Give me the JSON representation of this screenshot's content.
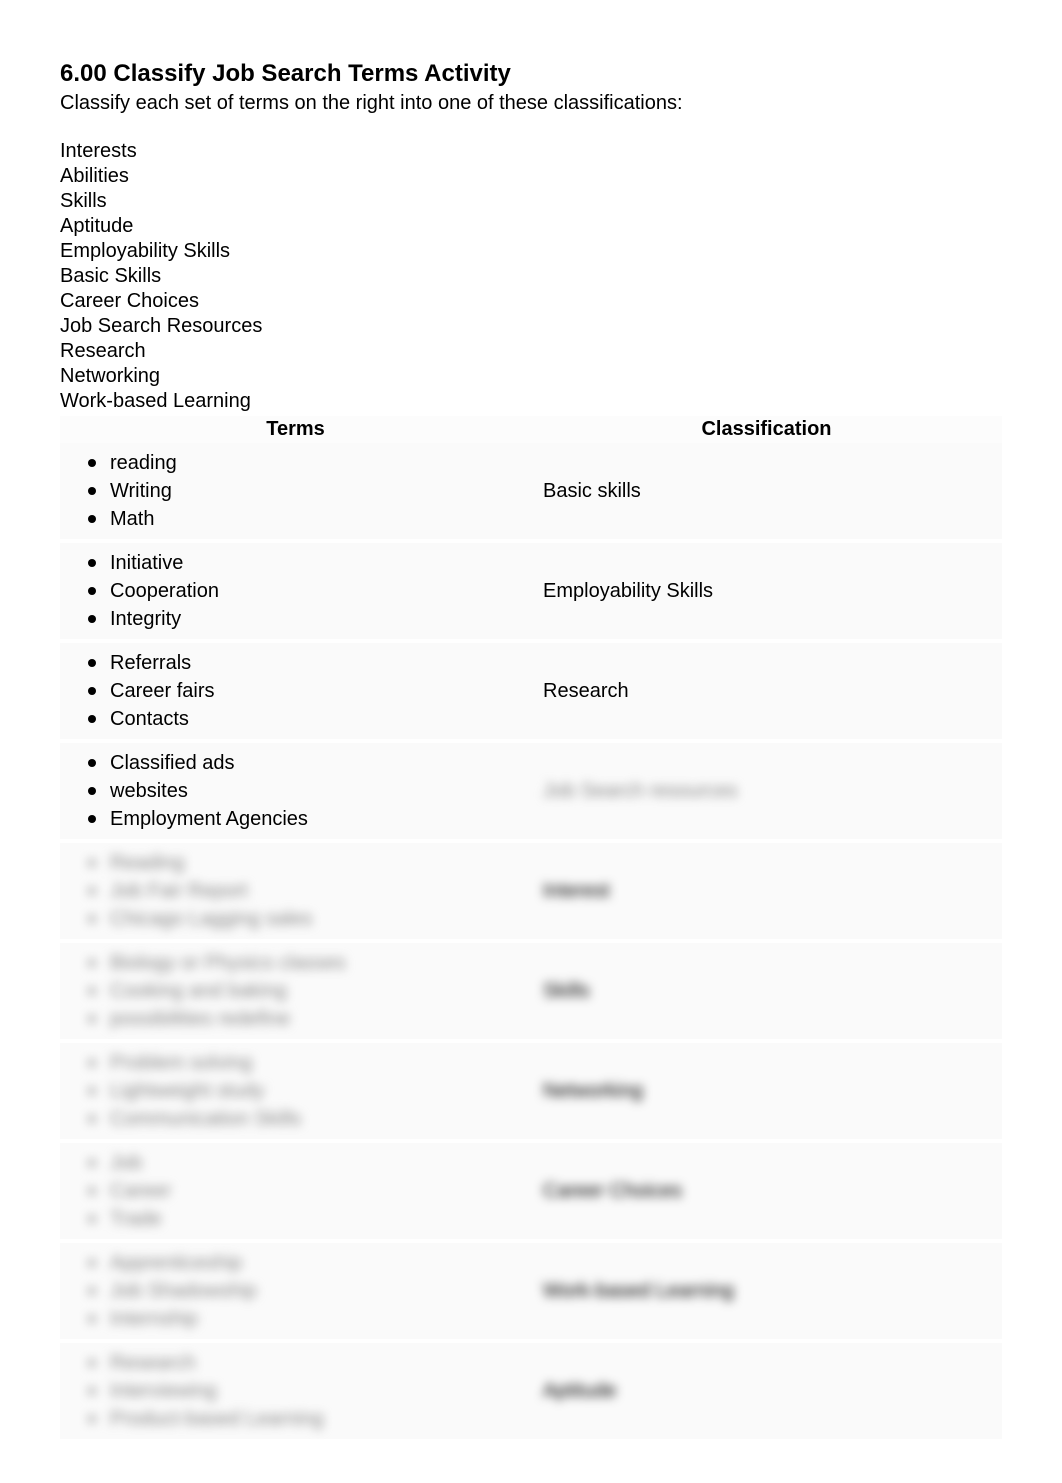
{
  "title": "6.00 Classify Job Search Terms Activity",
  "instructions": "Classify each set of terms on the right into one of these classifications:",
  "classifications_list": [
    "Interests",
    "Abilities",
    "Skills",
    "Aptitude",
    "Employability Skills",
    "Basic Skills",
    "Career Choices",
    "Job Search Resources",
    "Research",
    "Networking",
    "Work-based Learning"
  ],
  "table": {
    "header_terms": "Terms",
    "header_classification": "Classification",
    "rows": [
      {
        "terms": [
          "reading",
          "Writing",
          "Math"
        ],
        "classification": "Basic skills",
        "blurred": false
      },
      {
        "terms": [
          "Initiative",
          "Cooperation",
          "Integrity"
        ],
        "classification": "Employability Skills",
        "blurred": false
      },
      {
        "terms": [
          "Referrals",
          "Career fairs",
          "Contacts"
        ],
        "classification": "Research",
        "blurred": false
      },
      {
        "terms": [
          "Classified ads",
          "websites",
          "Employment Agencies"
        ],
        "classification": "Job Search resources",
        "blurred_class": true
      },
      {
        "terms": [
          "Reading",
          "Job Fair Report",
          "Chicago Lagging sales"
        ],
        "classification": "Interest",
        "blurred": true
      },
      {
        "terms": [
          "Biology or Physics classes",
          "Cooking and baking",
          "possibilities redefine"
        ],
        "classification": "Skills",
        "blurred": true
      },
      {
        "terms": [
          "Problem solving",
          "Lightweight study",
          "Communication Skills"
        ],
        "classification": "Networking",
        "blurred": true
      },
      {
        "terms": [
          "Job",
          "Career",
          "Trade"
        ],
        "classification": "Career Choices",
        "blurred": true
      },
      {
        "terms": [
          "Apprenticeship",
          "Job Shadowship",
          "Internship"
        ],
        "classification": "Work-based Learning",
        "blurred": true
      },
      {
        "terms": [
          "Research",
          "Interviewing",
          "Product-based Learning"
        ],
        "classification": "Aptitude",
        "blurred": true
      }
    ]
  }
}
